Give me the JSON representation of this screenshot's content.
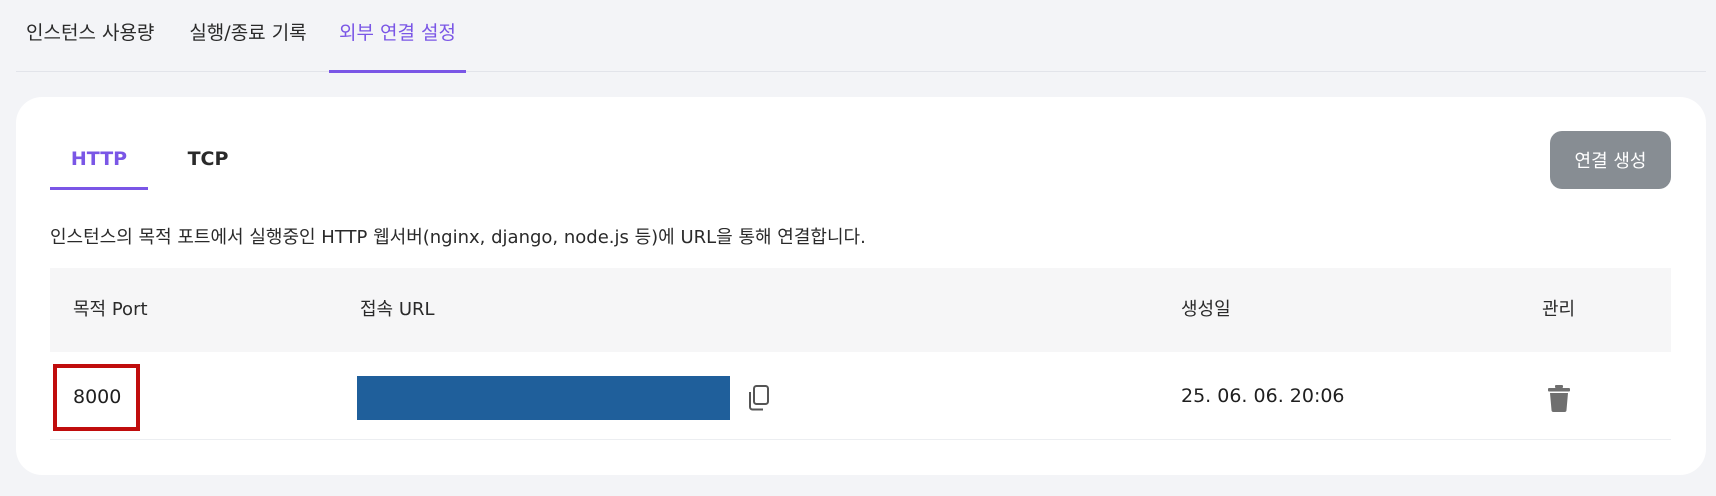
{
  "top_tabs": {
    "usage": "인스턴스 사용량",
    "history": "실행/종료 기록",
    "external": "외부 연결 설정"
  },
  "sub_tabs": {
    "http": "HTTP",
    "tcp": "TCP"
  },
  "create_button_label": "연결 생성",
  "description": "인스턴스의 목적 포트에서 실행중인 HTTP 웹서버(nginx, django, node.js 등)에 URL을 통해 연결합니다.",
  "table": {
    "headers": {
      "port": "목적 Port",
      "url": "접속 URL",
      "created": "생성일",
      "manage": "관리"
    },
    "rows": [
      {
        "port": "8000",
        "created": "25. 06. 06. 20:06"
      }
    ]
  },
  "colors": {
    "accent": "#7a56e6",
    "button": "#878d93",
    "highlight_border": "#c00d0d",
    "redacted_url": "#1f5f9b"
  },
  "icons": {
    "copy": "copy-icon",
    "delete": "trash-icon"
  }
}
